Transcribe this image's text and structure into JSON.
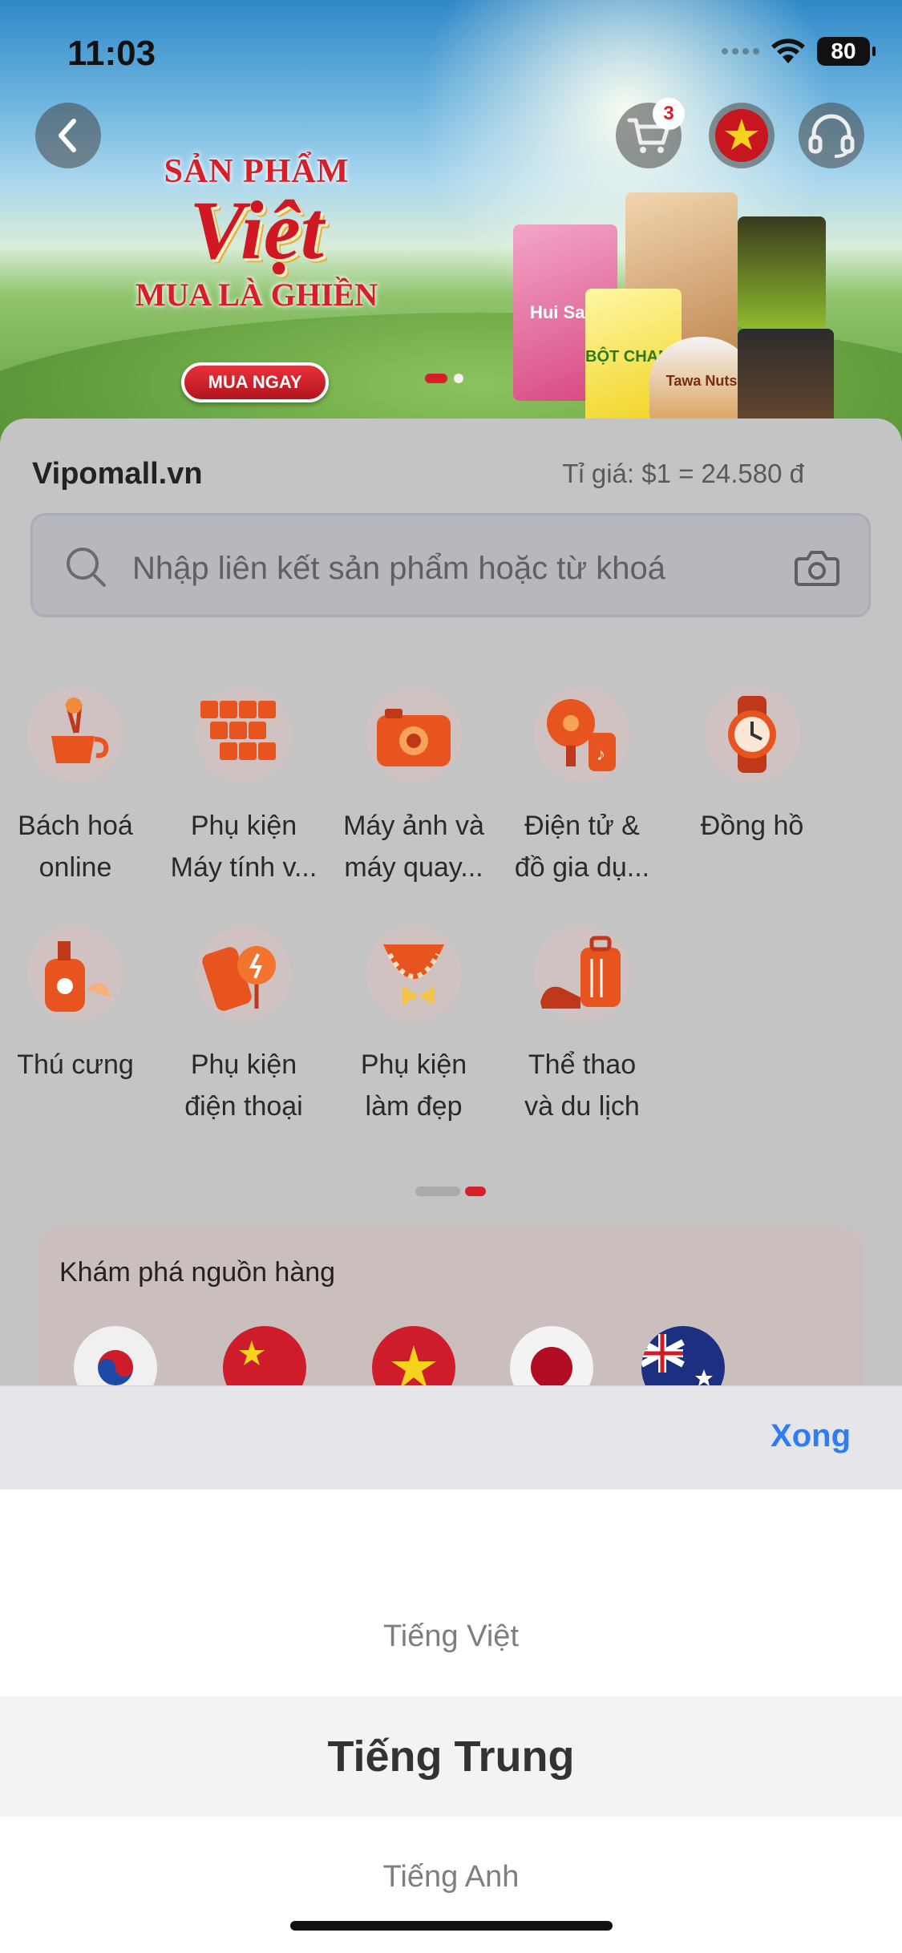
{
  "status_bar": {
    "time": "11:03",
    "battery": "80"
  },
  "header": {
    "cart_count": "3"
  },
  "banner": {
    "line1": "SẢN PHẨM",
    "line2": "Việt",
    "line3": "MUA LÀ GHIỀN",
    "cta": "MUA NGAY",
    "products": [
      "Hui Sata",
      "BỘT CHANH",
      "Tawa Nuts"
    ]
  },
  "store": {
    "name": "Vipomall.vn",
    "exchange_rate": "Tỉ giá: $1 = 24.580 đ"
  },
  "search": {
    "placeholder": "Nhập liên kết sản phẩm hoặc từ khoá"
  },
  "categories": [
    {
      "label": "Bách hoá\nonline",
      "icon": "mixer-icon"
    },
    {
      "label": "Phụ kiện\nMáy tính v...",
      "icon": "keyboard-icon"
    },
    {
      "label": "Máy ảnh và\nmáy quay...",
      "icon": "camera-icon"
    },
    {
      "label": "Điện tử &\nđồ gia dụ...",
      "icon": "fan-speaker-icon"
    },
    {
      "label": "Đồng hồ",
      "icon": "watch-icon"
    },
    {
      "label": "Thú cưng",
      "icon": "pet-care-icon"
    },
    {
      "label": "Phụ kiện\nđiện thoại",
      "icon": "phone-charger-icon"
    },
    {
      "label": "Phụ kiện\nlàm đẹp",
      "icon": "necklace-icon"
    },
    {
      "label": "Thể thao\nvà du lịch",
      "icon": "luggage-icon"
    }
  ],
  "explore": {
    "title": "Khám phá nguồn hàng",
    "flags": [
      "korea-flag",
      "china-flag",
      "vietnam-flag",
      "japan-flag",
      "australia-flag"
    ]
  },
  "picker": {
    "done_label": "Xong",
    "options": [
      "Tiếng Việt",
      "Tiếng Trung",
      "Tiếng Anh"
    ],
    "selected_index": 1
  },
  "colors": {
    "accent": "#d71f2a",
    "done_blue": "#2e7cf6",
    "icon_orange": "#e8541f"
  }
}
